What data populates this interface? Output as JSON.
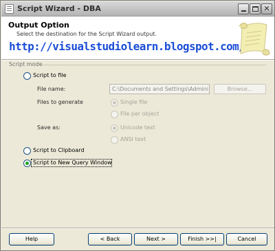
{
  "window": {
    "title": "Script Wizard - DBA",
    "controls": [
      "minimize",
      "maximize",
      "close"
    ]
  },
  "header": {
    "title": "Output Option",
    "subtitle": "Select the destination for the Script Wizard output.",
    "watermark": "http://visualstudiolearn.blogspot.com/"
  },
  "script_mode": {
    "group_label": "Script mode",
    "options": [
      {
        "label": "Script to file",
        "selected": false
      },
      {
        "label": "Script to Clipboard",
        "selected": false
      },
      {
        "label": "Script to New Query Window",
        "selected": true
      }
    ],
    "file_name": {
      "label": "File name:",
      "value": "C:\\Documents and Settings\\Admini",
      "browse_label": "Browse..."
    },
    "files_to_generate": {
      "label": "Files to generate",
      "options": [
        {
          "label": "Single file",
          "selected": true
        },
        {
          "label": "File per object",
          "selected": false
        }
      ]
    },
    "save_as": {
      "label": "Save as:",
      "options": [
        {
          "label": "Unicode text",
          "selected": true
        },
        {
          "label": "ANSI text",
          "selected": false
        }
      ]
    }
  },
  "buttons": {
    "help": "Help",
    "back": "< Back",
    "next": "Next >",
    "finish": "Finish >>|",
    "cancel": "Cancel"
  },
  "colors": {
    "dialog_background": "#ece9d8",
    "header_background": "#ffffff",
    "watermark": "#1b4dd6",
    "selected_radio_dot": "#21a121",
    "disabled_text": "#a7a39a"
  },
  "icons": {
    "app": "script-document-icon",
    "header": "script-scroll-icon"
  }
}
